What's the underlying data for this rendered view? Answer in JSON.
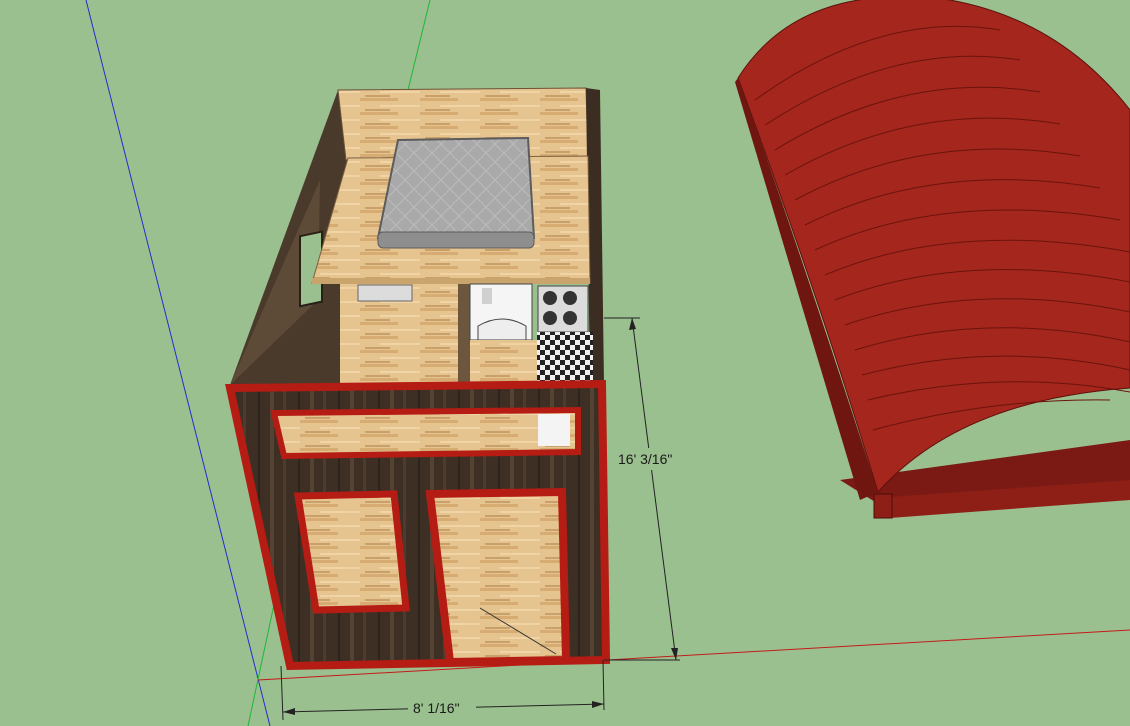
{
  "dimensions": {
    "height_label": "16' 3/16\"",
    "width_label": "8' 1/16\""
  },
  "colors": {
    "ground": "#9bc08f",
    "trim_red": "#b51c14",
    "dark_wood": "#3f3126",
    "light_wood": "#e2c08c",
    "roof_red": "#a4261c",
    "mattress": "#a8a8a8"
  }
}
